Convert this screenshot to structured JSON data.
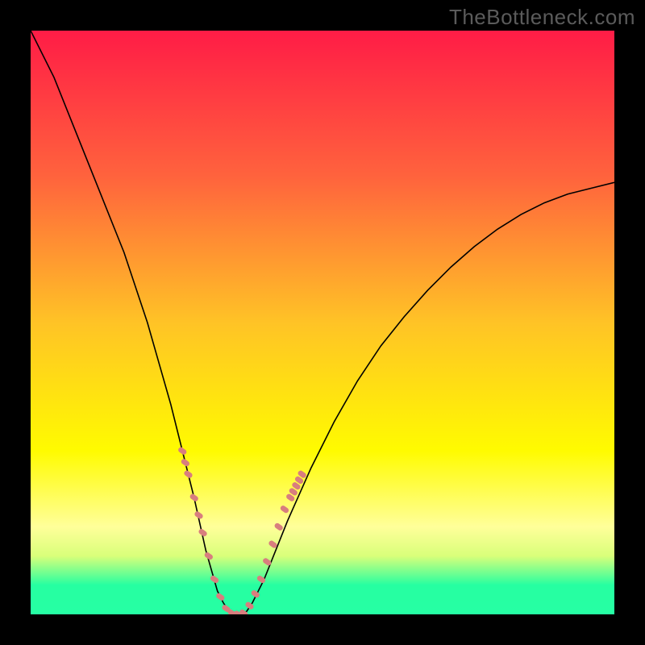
{
  "watermark": "TheBottleneck.com",
  "chart_data": {
    "type": "line",
    "title": "",
    "xlabel": "",
    "ylabel": "",
    "xlim": [
      0,
      100
    ],
    "ylim": [
      0,
      100
    ],
    "x_tick_labels": [],
    "y_tick_labels": [],
    "grid": false,
    "legend": false,
    "background_gradient": {
      "stops": [
        {
          "pos": 0.0,
          "color": "#ff1c46"
        },
        {
          "pos": 0.25,
          "color": "#ff633d"
        },
        {
          "pos": 0.5,
          "color": "#ffc326"
        },
        {
          "pos": 0.72,
          "color": "#fffb00"
        },
        {
          "pos": 0.85,
          "color": "#ffff9a"
        },
        {
          "pos": 0.9,
          "color": "#d9ff7a"
        },
        {
          "pos": 0.95,
          "color": "#26ffa1"
        },
        {
          "pos": 1.0,
          "color": "#26ffa4"
        }
      ]
    },
    "series": [
      {
        "name": "curve",
        "color": "#000000",
        "stroke_width": 1.6,
        "x": [
          0,
          4,
          8,
          12,
          16,
          20,
          22,
          24,
          26,
          28,
          30,
          32,
          33,
          34,
          35,
          36,
          37,
          38,
          40,
          44,
          48,
          52,
          56,
          60,
          64,
          68,
          72,
          76,
          80,
          84,
          88,
          92,
          96,
          100
        ],
        "y": [
          100,
          92,
          82,
          72,
          62,
          50,
          43,
          36,
          28,
          20,
          11,
          4,
          2,
          0.5,
          0,
          0,
          0.5,
          2,
          6,
          16,
          25,
          33,
          40,
          46,
          51,
          55.5,
          59.5,
          63,
          66,
          68.5,
          70.5,
          72,
          73,
          74
        ]
      },
      {
        "name": "markers",
        "marker_only": true,
        "color": "#d87e7e",
        "marker_size": 11,
        "x": [
          26.0,
          26.5,
          27.0,
          28.0,
          28.8,
          29.5,
          30.5,
          31.5,
          32.5,
          33.5,
          34.5,
          35.5,
          36.5,
          37.5,
          38.5,
          39.5,
          40.5,
          41.5,
          42.5,
          43.5,
          44.5,
          45.0,
          45.5,
          46.0,
          46.5
        ],
        "y": [
          28.0,
          26.0,
          24.0,
          20.0,
          17.0,
          14.0,
          10.0,
          6.0,
          3.0,
          1.0,
          0.2,
          0.0,
          0.2,
          1.5,
          3.5,
          6.0,
          9.0,
          12.0,
          15.0,
          18.0,
          20.0,
          21.0,
          22.0,
          23.0,
          24.0
        ]
      }
    ]
  }
}
